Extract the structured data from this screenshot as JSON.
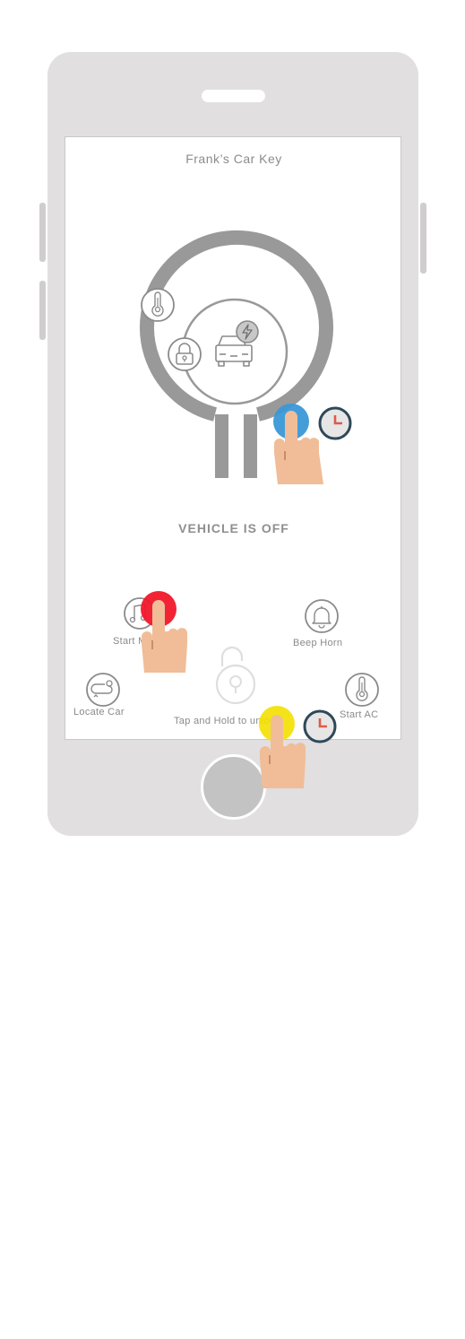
{
  "app": {
    "title": "Frank’s Car Key",
    "status": "VEHICLE IS OFF"
  },
  "actions": {
    "start_music": "Start M",
    "beep_horn": "Beep Horn",
    "locate_car": "Locate Car",
    "start_ac": "Start AC",
    "unlock_hint": "Tap and Hold to unlock"
  },
  "gesture_colors": {
    "power_tap": "#3a98d6",
    "music_tap": "#f2172b",
    "unlock_tap": "#f4e000",
    "hand": "#f0bd98",
    "timer_ring": "#2f4858",
    "timer_hand": "#e05a4a"
  },
  "icons": [
    "thermometer-icon",
    "lock-icon",
    "car-icon",
    "charging-icon",
    "power-icon",
    "music-icon",
    "bell-icon",
    "location-icon",
    "unlock-icon",
    "timer-icon",
    "hand-pointer-icon"
  ]
}
